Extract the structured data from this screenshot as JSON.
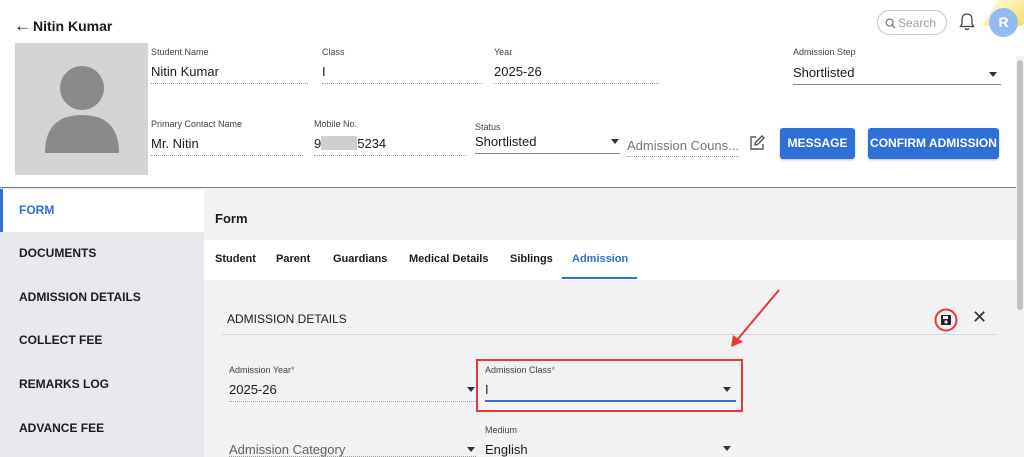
{
  "header": {
    "back_icon": "arrow-left-icon",
    "title": "Nitin Kumar",
    "search_placeholder": "Search",
    "avatar_initial": "R"
  },
  "student": {
    "name_label": "Student Name",
    "name_value": "Nitin Kumar",
    "class_label": "Class",
    "class_value": "I",
    "year_label": "Year",
    "year_value": "2025-26",
    "admission_step_label": "Admission Step",
    "admission_step_value": "Shortlisted",
    "contact_label": "Primary Contact Name",
    "contact_value": "Mr. Nitin",
    "mobile_label": "Mobile No.",
    "mobile_prefix": "9",
    "mobile_suffix": "5234",
    "status_label": "Status",
    "status_value": "Shortlisted",
    "counsellor_placeholder": "Admission Couns..."
  },
  "actions": {
    "message": "MESSAGE",
    "confirm": "CONFIRM ADMISSION"
  },
  "sidebar": {
    "items": [
      {
        "label": "FORM",
        "active": true
      },
      {
        "label": "DOCUMENTS"
      },
      {
        "label": "ADMISSION DETAILS"
      },
      {
        "label": "COLLECT FEE"
      },
      {
        "label": "REMARKS LOG"
      },
      {
        "label": "ADVANCE FEE"
      }
    ]
  },
  "main": {
    "title": "Form",
    "tabs": [
      {
        "label": "Student"
      },
      {
        "label": "Parent"
      },
      {
        "label": "Guardians"
      },
      {
        "label": "Medical Details"
      },
      {
        "label": "Siblings"
      },
      {
        "label": "Admission",
        "active": true
      }
    ],
    "section_title": "ADMISSION DETAILS",
    "fields": {
      "admission_year_label": "Admission Year",
      "admission_year_value": "2025-26",
      "admission_class_label": "Admission Class",
      "admission_class_value": "I",
      "admission_category_placeholder": "Admission Category",
      "medium_label": "Medium",
      "medium_value": "English",
      "required_mark": "*"
    }
  },
  "colors": {
    "accent": "#2f6fd8",
    "annotation": "#e53935",
    "sidebar_bg": "#e9e9ed"
  }
}
